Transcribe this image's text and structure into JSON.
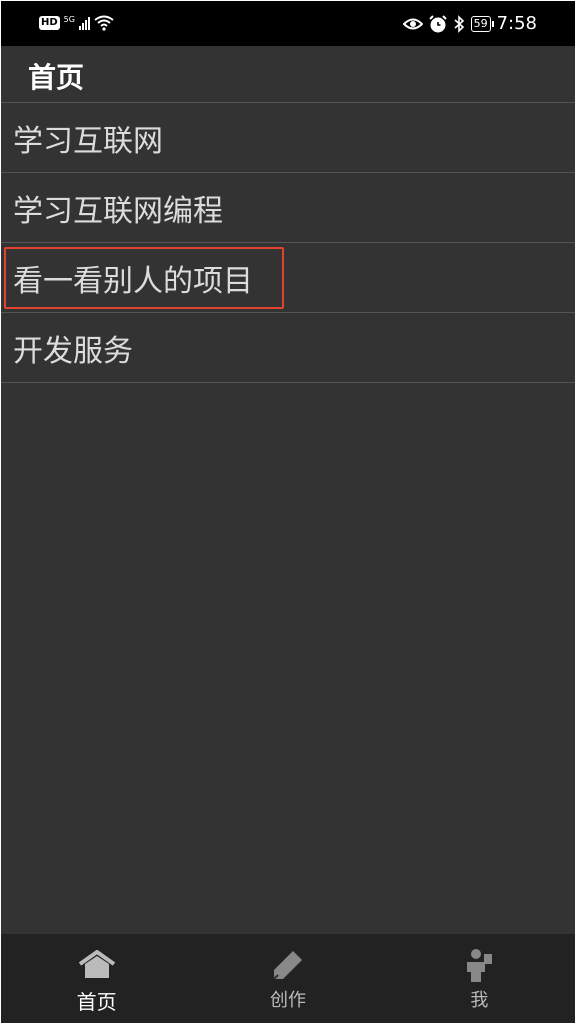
{
  "status_bar": {
    "hd_badge": "HD",
    "network_type": "5G",
    "battery_level": "59",
    "time": "7:58",
    "icons": [
      "signal-icon",
      "wifi-icon",
      "eye-icon",
      "alarm-icon",
      "bluetooth-icon",
      "battery-icon"
    ]
  },
  "header": {
    "title": "首页"
  },
  "list": {
    "items": [
      {
        "label": "学习互联网"
      },
      {
        "label": "学习互联网编程"
      },
      {
        "label": "看一看别人的项目"
      },
      {
        "label": "开发服务"
      }
    ],
    "highlight_color": "#e0442e"
  },
  "bottom_nav": {
    "items": [
      {
        "label": "首页",
        "icon": "home-icon",
        "active": true
      },
      {
        "label": "创作",
        "icon": "pencil-icon",
        "active": false
      },
      {
        "label": "我",
        "icon": "person-icon",
        "active": false
      }
    ]
  },
  "colors": {
    "background": "#333333",
    "status_bar": "#000000",
    "bottom_nav": "#222222",
    "text": "#dcdcdc"
  }
}
